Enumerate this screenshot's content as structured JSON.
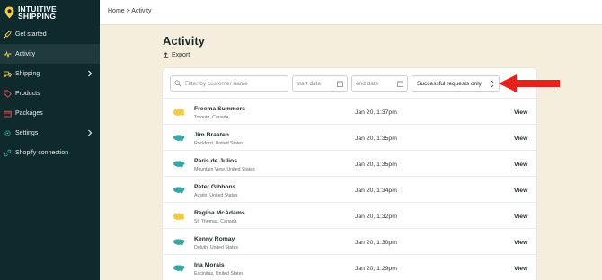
{
  "brand": {
    "line1": "INTUITIVE",
    "line2": "SHIPPING"
  },
  "sidebar": {
    "items": [
      {
        "label": "Get started",
        "icon": "rocket-icon"
      },
      {
        "label": "Activity",
        "icon": "activity-icon"
      },
      {
        "label": "Shipping",
        "icon": "truck-icon"
      },
      {
        "label": "Products",
        "icon": "tag-icon"
      },
      {
        "label": "Packages",
        "icon": "box-icon"
      },
      {
        "label": "Settings",
        "icon": "gear-icon"
      },
      {
        "label": "Shopify connection",
        "icon": "link-icon"
      }
    ]
  },
  "breadcrumb": {
    "home": "Home",
    "separator": ">",
    "current": "Activity"
  },
  "page": {
    "title": "Activity",
    "export_label": "Export"
  },
  "filters": {
    "search_placeholder": "Filter by customer name",
    "start_placeholder": "start date",
    "end_placeholder": "end date",
    "status_selected": "Successful requests only"
  },
  "rows": [
    {
      "name": "Freema Summers",
      "location": "Toronto, Canada",
      "date": "Jan 20, 1:37pm",
      "action": "View",
      "country": "canada"
    },
    {
      "name": "Jim Braaten",
      "location": "Rockford, United States",
      "date": "Jan 20, 1:35pm",
      "action": "View",
      "country": "us"
    },
    {
      "name": "Paris de Julios",
      "location": "Mountain View, United States",
      "date": "Jan 20, 1:35pm",
      "action": "View",
      "country": "us"
    },
    {
      "name": "Peter Gibbons",
      "location": "Austin, United States",
      "date": "Jan 20, 1:34pm",
      "action": "View",
      "country": "us"
    },
    {
      "name": "Regina McAdams",
      "location": "St. Thomas, Canada",
      "date": "Jan 20, 1:32pm",
      "action": "View",
      "country": "canada"
    },
    {
      "name": "Kenny Romay",
      "location": "Duluth, United States",
      "date": "Jan 20, 1:30pm",
      "action": "View",
      "country": "us"
    },
    {
      "name": "Ina Morais",
      "location": "Encinitas, United States",
      "date": "Jan 20, 1:29pm",
      "action": "View",
      "country": "us"
    }
  ],
  "colors": {
    "sidebar": "#0f2a2d",
    "accent": "#f2c94c",
    "us_map": "#3aa6a4",
    "canada_map": "#f2c94c",
    "arrow": "#e8221b",
    "background": "#f5eedd"
  }
}
